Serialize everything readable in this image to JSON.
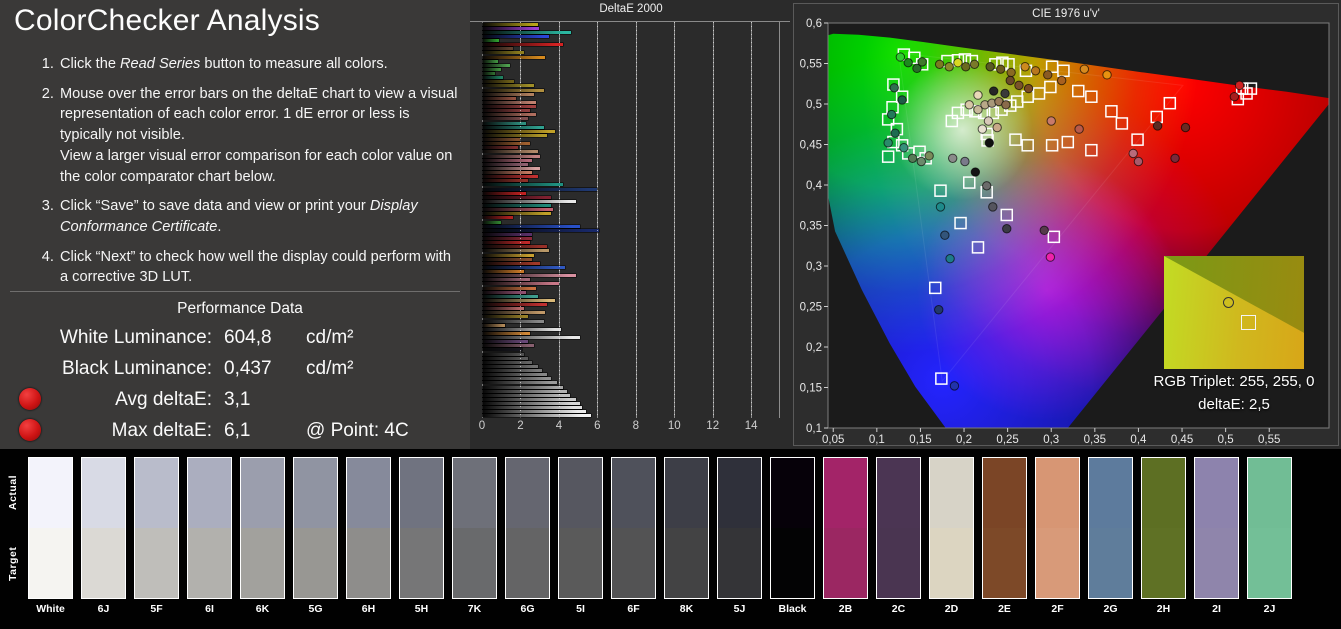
{
  "left_panel": {
    "title": "ColorChecker Analysis",
    "instructions": [
      {
        "parts": [
          {
            "t": "Click the "
          },
          {
            "t": "Read Series",
            "i": true
          },
          {
            "t": " button to measure all colors."
          }
        ]
      },
      {
        "parts": [
          {
            "t": "Mouse over the error bars on the deltaE chart to view a visual representation of each color error. 1 dE error or less is typically not visible."
          },
          {
            "br": true
          },
          {
            "t": "View a larger visual error comparison for each color value on the color comparator chart below."
          }
        ]
      },
      {
        "parts": [
          {
            "t": "Click “Save” to save data and view or print your "
          },
          {
            "t": "Display Conformance Certificate",
            "i": true
          },
          {
            "t": "."
          }
        ]
      },
      {
        "parts": [
          {
            "t": "Click “Next” to check how well the display could perform with a corrective 3D LUT."
          }
        ]
      }
    ],
    "performance": {
      "header": "Performance Data",
      "rows": [
        {
          "label": "White Luminance:",
          "value": "604,8",
          "unit": "cd/m²",
          "dot": false
        },
        {
          "label": "Black Luminance:",
          "value": "0,437",
          "unit": "cd/m²",
          "dot": false
        },
        {
          "label": "Avg deltaE:",
          "value": "3,1",
          "unit": "",
          "dot": true
        },
        {
          "label": "Max deltaE:",
          "value": "6,1",
          "unit": "@ Point: 4C",
          "dot": true
        }
      ]
    }
  },
  "chart_data": [
    {
      "type": "bar",
      "title": "DeltaE 2000",
      "orientation": "horizontal",
      "xlim": [
        0,
        15.5
      ],
      "xticks": [
        0,
        2,
        4,
        6,
        8,
        10,
        12,
        14
      ],
      "xtick_labels": [
        "0",
        "2",
        "4",
        "6",
        "8",
        "10",
        "12",
        "14"
      ],
      "grid": true,
      "bars": [
        [
          "#b8a418",
          2.9
        ],
        [
          "#9a3fd0",
          2.95
        ],
        [
          "#2bb6a0",
          4.65
        ],
        [
          "#2b46d8",
          3.5
        ],
        [
          "#2f9e2f",
          0.9
        ],
        [
          "#d42222",
          4.2
        ],
        [
          "#5e4030",
          1.6
        ],
        [
          "#8f7f1e",
          2.2
        ],
        [
          "#d4891e",
          3.3
        ],
        [
          "#3f8f3f",
          0.85
        ],
        [
          "#4fa04f",
          1.45
        ],
        [
          "#3f8f3f",
          1.0
        ],
        [
          "#2f6b2f",
          0.7
        ],
        [
          "#1f8060",
          1.1
        ],
        [
          "#6f6018",
          1.65
        ],
        [
          "#a08f28",
          2.7
        ],
        [
          "#b08f3f",
          3.2
        ],
        [
          "#b0805f",
          2.7
        ],
        [
          "#8f503f",
          1.75
        ],
        [
          "#c0806f",
          2.8
        ],
        [
          "#a04040",
          2.8
        ],
        [
          "#8f3f3f",
          2.5
        ],
        [
          "#b06f5f",
          2.8
        ],
        [
          "#7f4f4f",
          2.4
        ],
        [
          "#2f8f7f",
          2.3
        ],
        [
          "#2fa08f",
          3.2
        ],
        [
          "#c0a028",
          3.8
        ],
        [
          "#b09828",
          3.4
        ],
        [
          "#7f502f",
          2.0
        ],
        [
          "#a0602f",
          2.5
        ],
        [
          "#7f2f2f",
          1.85
        ],
        [
          "#b08868",
          2.9
        ],
        [
          "#c08080",
          3.0
        ],
        [
          "#b06878",
          2.6
        ],
        [
          "#8f6070",
          2.4
        ],
        [
          "#d8a0a0",
          3.0
        ],
        [
          "#c07860",
          2.6
        ],
        [
          "#c03030",
          2.9
        ],
        [
          "#8f3028",
          2.4
        ],
        [
          "#1f9080",
          4.2
        ],
        [
          "#1f3870",
          6.0
        ],
        [
          "#c02020",
          2.3
        ],
        [
          "#7f2030",
          3.6
        ],
        [
          "#e8e8e8",
          4.9
        ],
        [
          "#1f8878",
          3.6
        ],
        [
          "#c06070",
          3.7
        ],
        [
          "#c0a028",
          3.6
        ],
        [
          "#b02020",
          1.6
        ],
        [
          "#2f7f2f",
          1.0
        ],
        [
          "#2850c8",
          5.1
        ],
        [
          "#182868",
          6.1
        ],
        [
          "#583068",
          2.6
        ],
        [
          "#882838",
          2.6
        ],
        [
          "#c02828",
          2.5
        ],
        [
          "#983028",
          3.4
        ],
        [
          "#b89868",
          3.5
        ],
        [
          "#c8a030",
          2.7
        ],
        [
          "#885030",
          2.6
        ],
        [
          "#a03828",
          3.0
        ],
        [
          "#3058c0",
          4.3
        ],
        [
          "#c87828",
          2.2
        ],
        [
          "#d890a0",
          4.9
        ],
        [
          "#a06878",
          2.5
        ],
        [
          "#c87888",
          4.0
        ],
        [
          "#c87040",
          2.8
        ],
        [
          "#8f4f6f",
          2.3
        ],
        [
          "#3f9f8f",
          2.9
        ],
        [
          "#d8b878",
          3.8
        ],
        [
          "#c03030",
          3.4
        ],
        [
          "#b86868",
          2.2
        ],
        [
          "#c09868",
          3.3
        ],
        [
          "#988028",
          2.4
        ],
        [
          "#888888",
          3.2
        ],
        [
          "#b08858",
          1.2
        ],
        [
          "#e0e0e0",
          4.1
        ],
        [
          "#d08838",
          2.5
        ],
        [
          "#e8e8e8",
          5.1
        ],
        [
          "#684878",
          2.4
        ],
        [
          "#886070",
          2.7
        ],
        [
          "#181820",
          2.1
        ],
        [
          "#505050",
          2.2
        ],
        [
          "#5a5a5a",
          2.4
        ],
        [
          "#646464",
          2.6
        ],
        [
          "#707070",
          2.9
        ],
        [
          "#7a7a7a",
          3.1
        ],
        [
          "#868686",
          3.4
        ],
        [
          "#909090",
          3.6
        ],
        [
          "#9a9a9a",
          3.9
        ],
        [
          "#a6a6a6",
          4.2
        ],
        [
          "#b2b2b2",
          4.4
        ],
        [
          "#bebebe",
          4.6
        ],
        [
          "#cacaca",
          4.9
        ],
        [
          "#d6d6d6",
          5.1
        ],
        [
          "#e0e0e0",
          5.2
        ],
        [
          "#eaeaea",
          5.4
        ],
        [
          "#f4f4f4",
          5.65
        ]
      ]
    },
    {
      "type": "scatter",
      "title": "CIE 1976 u'v'",
      "xlim": [
        0.044,
        0.618
      ],
      "ylim": [
        0.1,
        0.6
      ],
      "xticks": [
        0.05,
        0.1,
        0.15,
        0.2,
        0.25,
        0.3,
        0.35,
        0.4,
        0.45,
        0.5,
        0.55
      ],
      "xtick_labels": [
        "0,05",
        "0,1",
        "0,15",
        "0,2",
        "0,25",
        "0,3",
        "0,35",
        "0,4",
        "0,45",
        "0,5",
        "0,55"
      ],
      "yticks": [
        0.6,
        0.55,
        0.5,
        0.45,
        0.4,
        0.35,
        0.3,
        0.25,
        0.2,
        0.15,
        0.1
      ],
      "ytick_labels": [
        "0,6",
        "0,55",
        "0,5",
        "0,45",
        "0,4",
        "0,35",
        "0,3",
        "0,25",
        "0,2",
        "0,15",
        "0,1"
      ],
      "gamut_primaries": {
        "red": [
          0.451,
          0.523
        ],
        "green": [
          0.125,
          0.563
        ],
        "blue": [
          0.175,
          0.158
        ],
        "white": [
          0.198,
          0.468
        ]
      },
      "target_squares": [
        [
          0.131,
          0.561
        ],
        [
          0.143,
          0.557
        ],
        [
          0.152,
          0.549
        ],
        [
          0.119,
          0.524
        ],
        [
          0.129,
          0.509
        ],
        [
          0.118,
          0.496
        ],
        [
          0.113,
          0.481
        ],
        [
          0.123,
          0.469
        ],
        [
          0.119,
          0.453
        ],
        [
          0.129,
          0.449
        ],
        [
          0.136,
          0.439
        ],
        [
          0.149,
          0.441
        ],
        [
          0.156,
          0.433
        ],
        [
          0.113,
          0.435
        ],
        [
          0.181,
          0.553
        ],
        [
          0.193,
          0.554
        ],
        [
          0.201,
          0.555
        ],
        [
          0.209,
          0.553
        ],
        [
          0.236,
          0.549
        ],
        [
          0.244,
          0.551
        ],
        [
          0.251,
          0.549
        ],
        [
          0.271,
          0.541
        ],
        [
          0.301,
          0.546
        ],
        [
          0.314,
          0.541
        ],
        [
          0.331,
          0.516
        ],
        [
          0.346,
          0.509
        ],
        [
          0.299,
          0.521
        ],
        [
          0.286,
          0.513
        ],
        [
          0.273,
          0.509
        ],
        [
          0.261,
          0.503
        ],
        [
          0.253,
          0.498
        ],
        [
          0.243,
          0.493
        ],
        [
          0.233,
          0.489
        ],
        [
          0.223,
          0.489
        ],
        [
          0.213,
          0.491
        ],
        [
          0.203,
          0.493
        ],
        [
          0.193,
          0.489
        ],
        [
          0.186,
          0.479
        ],
        [
          0.226,
          0.463
        ],
        [
          0.259,
          0.456
        ],
        [
          0.273,
          0.449
        ],
        [
          0.301,
          0.449
        ],
        [
          0.319,
          0.453
        ],
        [
          0.346,
          0.443
        ],
        [
          0.369,
          0.491
        ],
        [
          0.381,
          0.476
        ],
        [
          0.399,
          0.456
        ],
        [
          0.421,
          0.484
        ],
        [
          0.436,
          0.501
        ],
        [
          0.519,
          0.519
        ],
        [
          0.524,
          0.513
        ],
        [
          0.529,
          0.519
        ],
        [
          0.514,
          0.506
        ],
        [
          0.206,
          0.403
        ],
        [
          0.226,
          0.391
        ],
        [
          0.249,
          0.363
        ],
        [
          0.173,
          0.393
        ],
        [
          0.196,
          0.353
        ],
        [
          0.216,
          0.323
        ],
        [
          0.303,
          0.336
        ],
        [
          0.167,
          0.273
        ],
        [
          0.174,
          0.161
        ],
        [
          0.227,
          0.455
        ]
      ],
      "measured_circles": [
        [
          0.127,
          0.558,
          "#2ecc2e"
        ],
        [
          0.136,
          0.551,
          "#1e8a1e"
        ],
        [
          0.146,
          0.544,
          "#2a6b2a"
        ],
        [
          0.152,
          0.552,
          "#3f7a2a"
        ],
        [
          0.12,
          0.52,
          "#2f6f4f"
        ],
        [
          0.129,
          0.505,
          "#1e5c46"
        ],
        [
          0.117,
          0.487,
          "#227a5a"
        ],
        [
          0.121,
          0.464,
          "#1d6b50"
        ],
        [
          0.113,
          0.452,
          "#2a8a6a"
        ],
        [
          0.131,
          0.446,
          "#35907a"
        ],
        [
          0.141,
          0.433,
          "#567a56"
        ],
        [
          0.151,
          0.429,
          "#6b8a6b"
        ],
        [
          0.16,
          0.436,
          "#7a8a5a"
        ],
        [
          0.172,
          0.549,
          "#7a7a22"
        ],
        [
          0.183,
          0.546,
          "#8a8a2a"
        ],
        [
          0.193,
          0.551,
          "#d8d822"
        ],
        [
          0.202,
          0.546,
          "#6b6b1e"
        ],
        [
          0.212,
          0.549,
          "#7a7a2a"
        ],
        [
          0.23,
          0.546,
          "#5a5a22"
        ],
        [
          0.242,
          0.543,
          "#6b5a1e"
        ],
        [
          0.254,
          0.539,
          "#8a6b22"
        ],
        [
          0.27,
          0.546,
          "#cc8a1e"
        ],
        [
          0.282,
          0.541,
          "#b8771e"
        ],
        [
          0.296,
          0.536,
          "#8a5a22"
        ],
        [
          0.312,
          0.529,
          "#a8601e"
        ],
        [
          0.338,
          0.543,
          "#d88a1e"
        ],
        [
          0.364,
          0.536,
          "#e89210"
        ],
        [
          0.253,
          0.529,
          "#6b4a2a"
        ],
        [
          0.263,
          0.523,
          "#7a522a"
        ],
        [
          0.274,
          0.519,
          "#7a4a22"
        ],
        [
          0.247,
          0.513,
          "#3a3a3a"
        ],
        [
          0.234,
          0.516,
          "#262626"
        ],
        [
          0.216,
          0.511,
          "#e8d8b8"
        ],
        [
          0.206,
          0.499,
          "#d8c8a8"
        ],
        [
          0.216,
          0.493,
          "#c8b898"
        ],
        [
          0.224,
          0.499,
          "#b8a888"
        ],
        [
          0.232,
          0.501,
          "#a8987a"
        ],
        [
          0.24,
          0.503,
          "#987a5a"
        ],
        [
          0.248,
          0.499,
          "#8a6b4a"
        ],
        [
          0.228,
          0.479,
          "#d8c8b8"
        ],
        [
          0.238,
          0.471,
          "#c8a888"
        ],
        [
          0.221,
          0.469,
          "#e8e0d0"
        ],
        [
          0.229,
          0.452,
          "#101010"
        ],
        [
          0.3,
          0.479,
          "#c87a6b"
        ],
        [
          0.332,
          0.469,
          "#b85a4a"
        ],
        [
          0.422,
          0.473,
          "#5a2a22"
        ],
        [
          0.454,
          0.471,
          "#6b2a22"
        ],
        [
          0.394,
          0.439,
          "#b86b7a"
        ],
        [
          0.4,
          0.429,
          "#a85a6b"
        ],
        [
          0.442,
          0.433,
          "#7a2a3a"
        ],
        [
          0.516,
          0.523,
          "#cc2222"
        ],
        [
          0.51,
          0.509,
          "#a81e1e"
        ],
        [
          0.187,
          0.433,
          "#8a8a8a"
        ],
        [
          0.201,
          0.429,
          "#7a7a8a"
        ],
        [
          0.213,
          0.416,
          "#141414"
        ],
        [
          0.226,
          0.399,
          "#6b6b6b"
        ],
        [
          0.233,
          0.373,
          "#55555e"
        ],
        [
          0.249,
          0.346,
          "#3a3a44"
        ],
        [
          0.173,
          0.373,
          "#1e8a8a"
        ],
        [
          0.184,
          0.309,
          "#1e7a8a"
        ],
        [
          0.299,
          0.311,
          "#ee22aa"
        ],
        [
          0.292,
          0.344,
          "#553a4a"
        ],
        [
          0.171,
          0.246,
          "#22386b"
        ],
        [
          0.189,
          0.152,
          "#2233aa"
        ],
        [
          0.178,
          0.338,
          "#33557a"
        ]
      ],
      "inset": {
        "rgb": "RGB Triplet: 255, 255, 0",
        "de": "deltaE: 2,5"
      }
    }
  ],
  "comparator": {
    "row_labels": [
      "Actual",
      "Target"
    ],
    "swatches": [
      {
        "label": "White",
        "actual": "#f3f3fb",
        "target": "#f5f4f1"
      },
      {
        "label": "6J",
        "actual": "#d8dae5",
        "target": "#dbd9d4"
      },
      {
        "label": "5F",
        "actual": "#b9bccb",
        "target": "#bfbeba"
      },
      {
        "label": "6I",
        "actual": "#abaebf",
        "target": "#b2b1ad"
      },
      {
        "label": "6K",
        "actual": "#9b9ead",
        "target": "#a2a19d"
      },
      {
        "label": "5G",
        "actual": "#9094a2",
        "target": "#989793"
      },
      {
        "label": "6H",
        "actual": "#868a9b",
        "target": "#8e8d8b"
      },
      {
        "label": "5H",
        "actual": "#707380",
        "target": "#767677"
      },
      {
        "label": "7K",
        "actual": "#6e7079",
        "target": "#696a6c"
      },
      {
        "label": "6G",
        "actual": "#656670",
        "target": "#646465"
      },
      {
        "label": "5I",
        "actual": "#565760",
        "target": "#5a5a5a"
      },
      {
        "label": "6F",
        "actual": "#4f515b",
        "target": "#535354"
      },
      {
        "label": "8K",
        "actual": "#3d3e47",
        "target": "#434344"
      },
      {
        "label": "5J",
        "actual": "#2f303a",
        "target": "#343437"
      },
      {
        "label": "Black",
        "actual": "#060109",
        "target": "#030304"
      },
      {
        "label": "2B",
        "actual": "#a32468",
        "target": "#9b2762"
      },
      {
        "label": "2C",
        "actual": "#4b3553",
        "target": "#4a3551"
      },
      {
        "label": "2D",
        "actual": "#d7d3c7",
        "target": "#dcd5c1"
      },
      {
        "label": "2E",
        "actual": "#7b4526",
        "target": "#7d4928"
      },
      {
        "label": "2F",
        "actual": "#d79674",
        "target": "#d89a79"
      },
      {
        "label": "2G",
        "actual": "#5d7b9d",
        "target": "#5f7d9b"
      },
      {
        "label": "2H",
        "actual": "#5d6f23",
        "target": "#5f7125"
      },
      {
        "label": "2I",
        "actual": "#8d83ad",
        "target": "#8f85ab"
      },
      {
        "label": "2J",
        "actual": "#71bd95",
        "target": "#73bf97"
      }
    ]
  }
}
